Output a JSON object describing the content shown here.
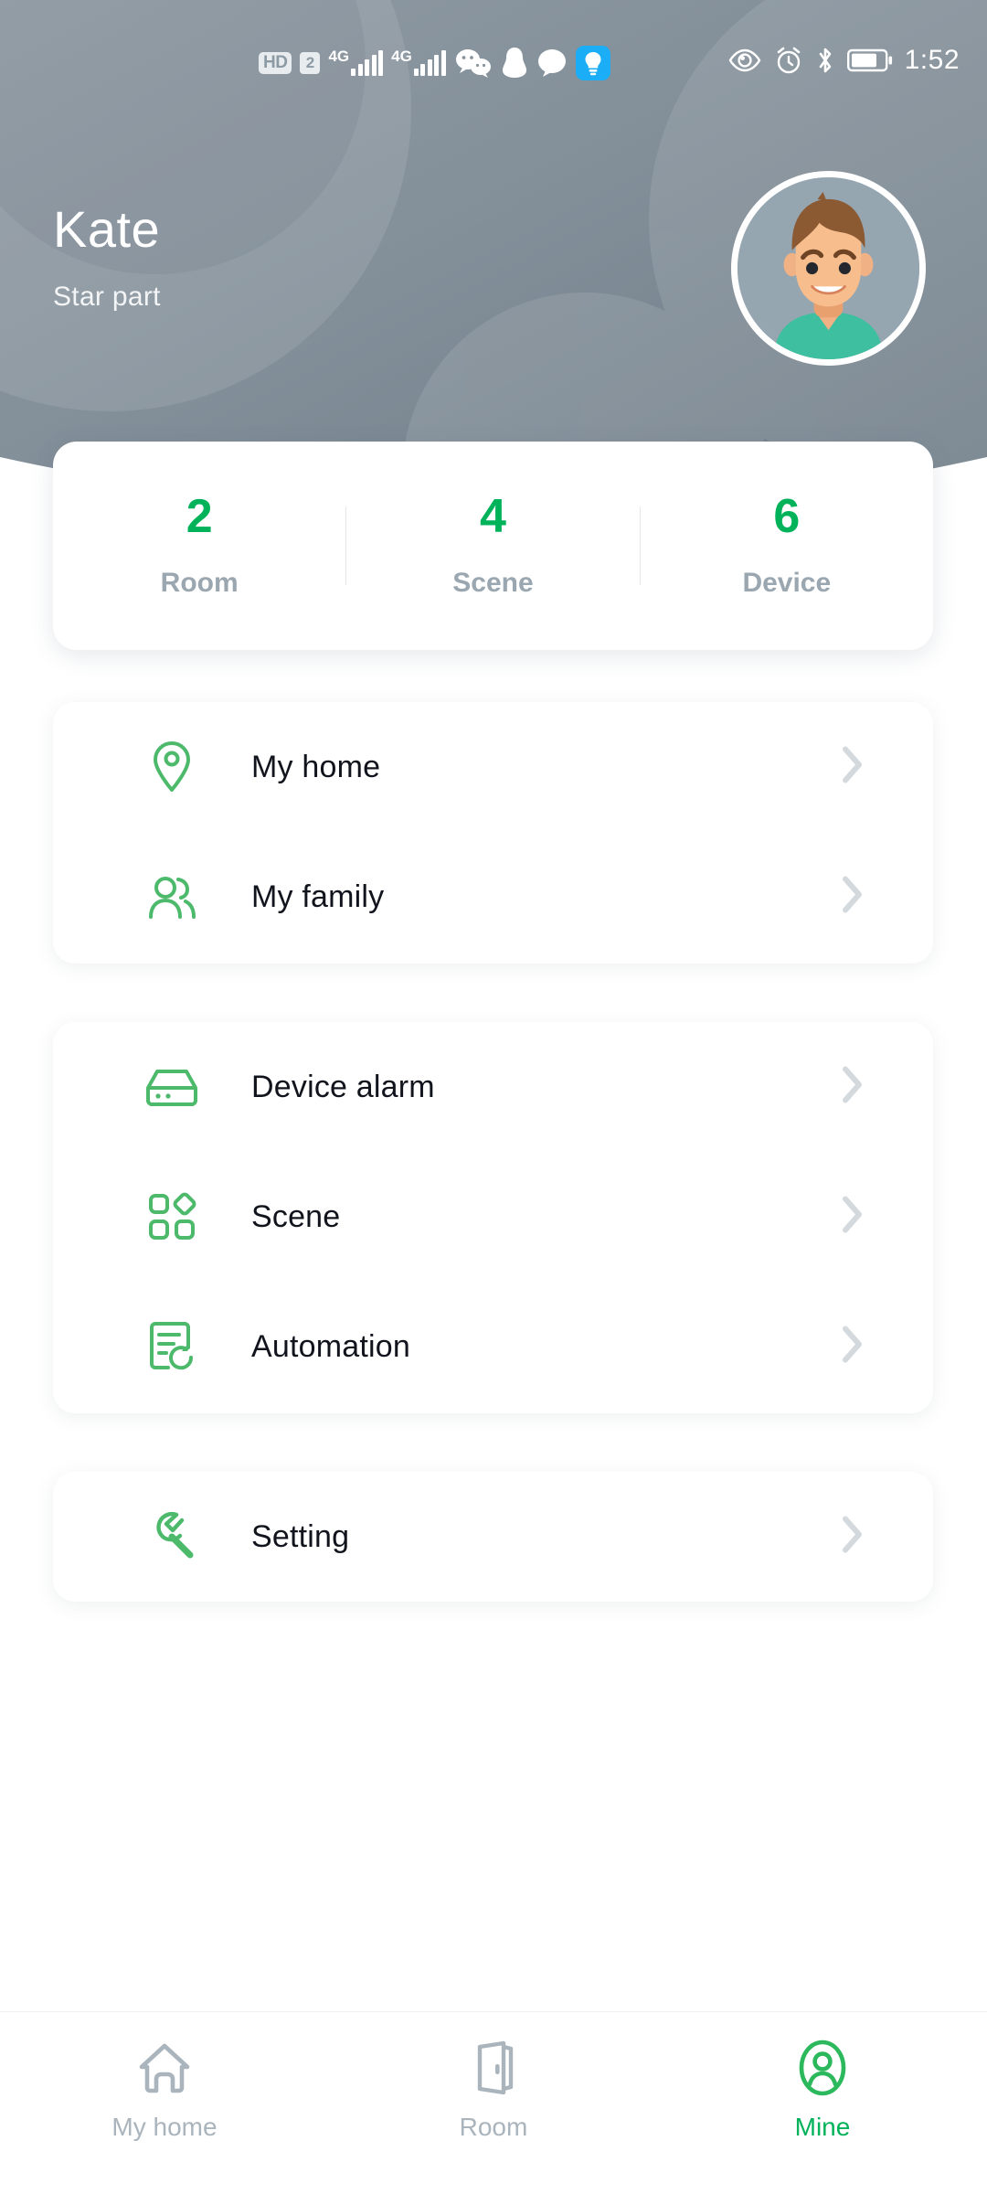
{
  "theme": {
    "accent": "#00b259",
    "header_gray": "#7d8992",
    "muted_text": "#9aa7b0",
    "title_text": "#11141c",
    "chip_blue": "#1badf5",
    "page_bg": "#ffffff"
  },
  "statusbar": {
    "time": "1:52",
    "hd_label": "HD",
    "sim_label": "2",
    "network_1": "4G",
    "network_2": "4G",
    "left_icons": [
      "hd-badge-icon",
      "sim-2-icon",
      "signal-4g-1-icon",
      "signal-4g-2-icon",
      "wechat-icon",
      "qq-penguin-icon",
      "message-bubble-icon",
      "lightbulb-icon"
    ],
    "right_icons": [
      "eye-care-icon",
      "alarm-clock-icon",
      "bluetooth-icon",
      "battery-icon"
    ]
  },
  "header": {
    "name": "Kate",
    "subtitle": "Star part",
    "avatar_name": "user-avatar"
  },
  "stats": [
    {
      "value": "2",
      "label": "Room"
    },
    {
      "value": "4",
      "label": "Scene"
    },
    {
      "value": "6",
      "label": "Device"
    }
  ],
  "groups": [
    {
      "id": "home-group",
      "rows": [
        {
          "label": "My home",
          "icon": "location-pin-icon"
        },
        {
          "label": "My family",
          "icon": "people-icon"
        }
      ]
    },
    {
      "id": "device-group",
      "rows": [
        {
          "label": "Device alarm",
          "icon": "device-box-icon"
        },
        {
          "label": "Scene",
          "icon": "grid-shapes-icon"
        },
        {
          "label": "Automation",
          "icon": "automation-refresh-icon"
        }
      ]
    },
    {
      "id": "setting-group",
      "rows": [
        {
          "label": "Setting",
          "icon": "wrench-icon"
        }
      ]
    }
  ],
  "tabs": [
    {
      "label": "My home",
      "icon": "home-outline-icon",
      "active": false
    },
    {
      "label": "Room",
      "icon": "door-icon",
      "active": false
    },
    {
      "label": "Mine",
      "icon": "person-circle-icon",
      "active": true
    }
  ]
}
